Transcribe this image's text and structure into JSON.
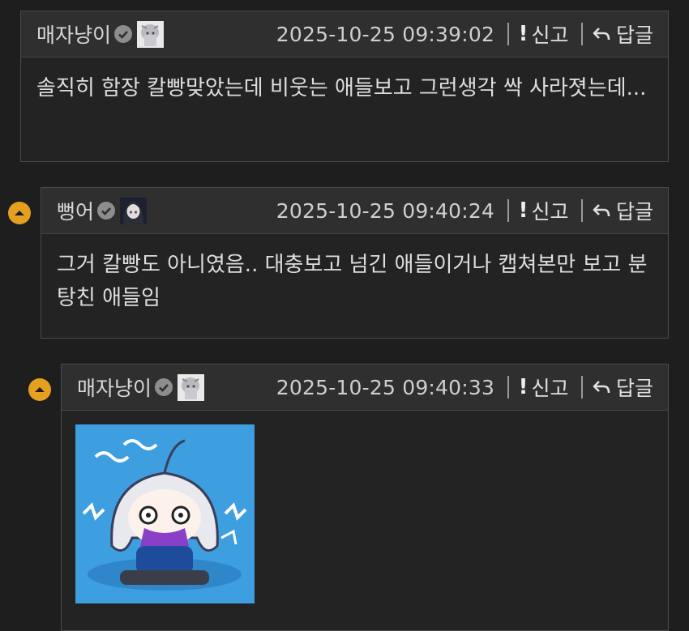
{
  "actions": {
    "report_label": "신고",
    "reply_label": "답글"
  },
  "comments": [
    {
      "author": "매자냥이",
      "timestamp": "2025-10-25 09:39:02",
      "text": "솔직히 함장 칼빵맞았는데 비웃는 애들보고 그런생각 싹 사라졋는데..."
    },
    {
      "author": "뻥어",
      "timestamp": "2025-10-25 09:40:24",
      "text": "그거 칼빵도 아니였음.. 대충보고 넘긴 애들이거나 캡쳐본만 보고 분탕친 애들임"
    },
    {
      "author": "매자냥이",
      "timestamp": "2025-10-25 09:40:33",
      "text": ""
    }
  ],
  "colors": {
    "toggle": "#e6a020",
    "sticker_bg": "#3d9ee0",
    "background": "#1e1e1e"
  }
}
